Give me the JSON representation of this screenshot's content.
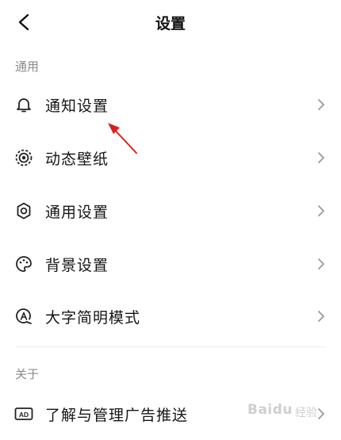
{
  "header": {
    "title": "设置"
  },
  "sections": [
    {
      "label": "通用",
      "items": [
        {
          "label": "通知设置",
          "icon": "bell-icon"
        },
        {
          "label": "动态壁纸",
          "icon": "live-wallpaper-icon"
        },
        {
          "label": "通用设置",
          "icon": "gear-icon"
        },
        {
          "label": "背景设置",
          "icon": "palette-icon"
        },
        {
          "label": "大字简明模式",
          "icon": "large-font-icon"
        }
      ]
    },
    {
      "label": "关于",
      "items": [
        {
          "label": "了解与管理广告推送",
          "icon": "ad-icon"
        }
      ]
    }
  ],
  "annotation": {
    "color": "#d9201c"
  },
  "watermark": {
    "brand": "Baidu",
    "sub": "经验"
  }
}
